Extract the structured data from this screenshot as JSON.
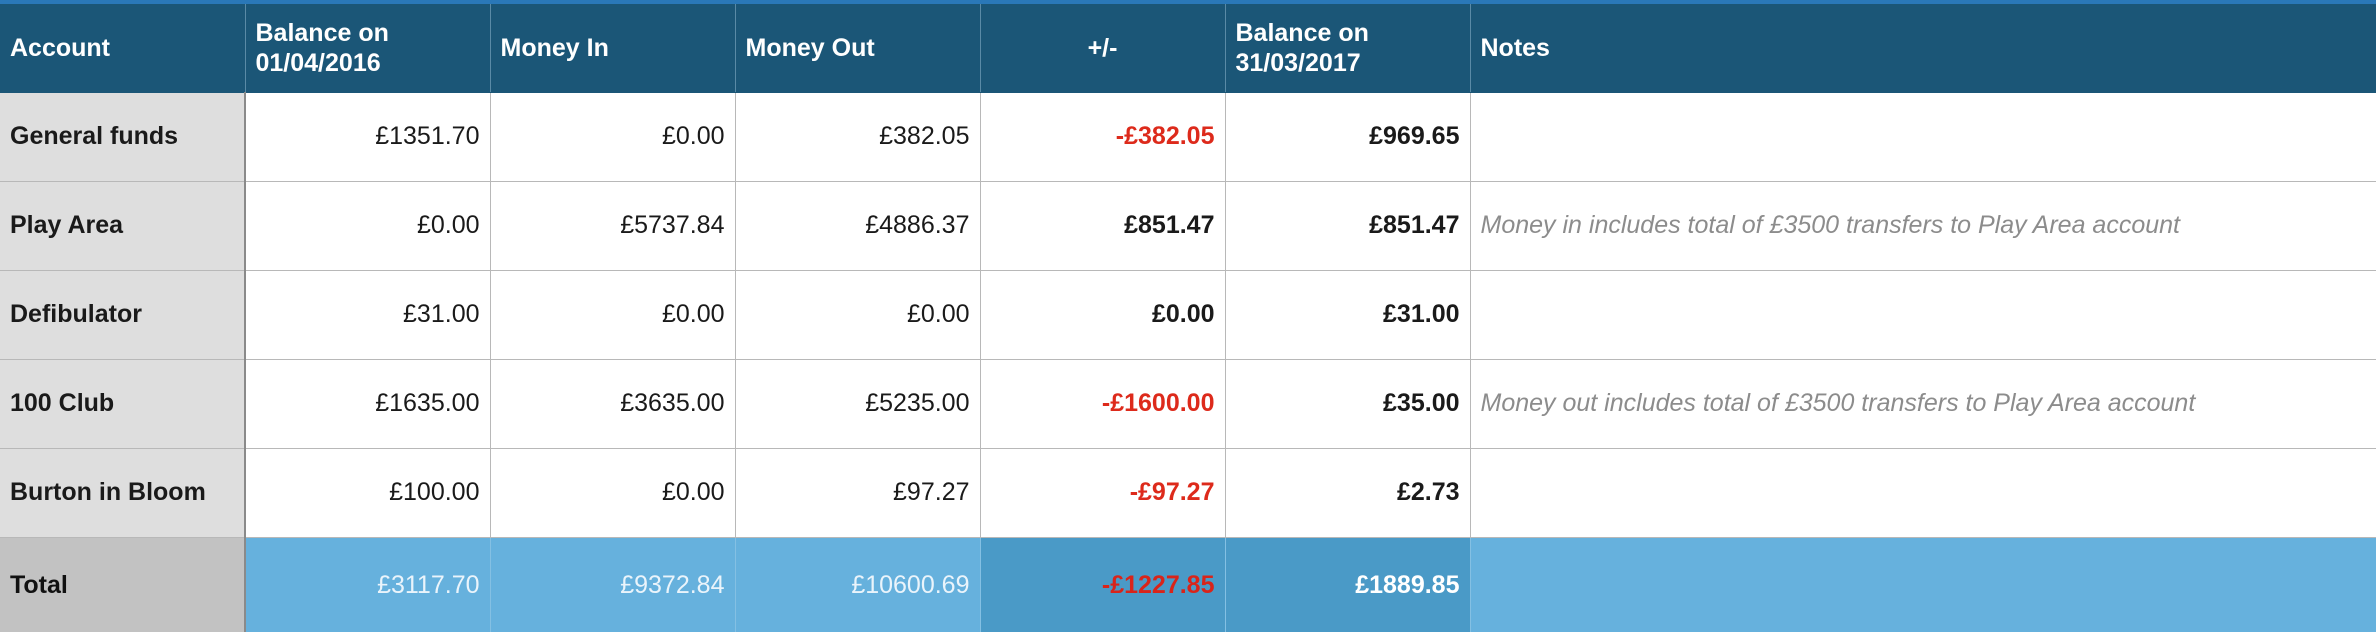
{
  "headers": {
    "account": "Account",
    "balance_start": [
      "Balance on",
      "01/04/2016"
    ],
    "money_in": "Money In",
    "money_out": "Money Out",
    "change": "+/-",
    "balance_end": [
      "Balance on",
      "31/03/2017"
    ],
    "notes": "Notes"
  },
  "rows": [
    {
      "account": "General funds",
      "balance_start": "£1351.70",
      "money_in": "£0.00",
      "money_out": "£382.05",
      "change": "-£382.05",
      "balance_end": "£969.65",
      "notes": ""
    },
    {
      "account": "Play Area",
      "balance_start": "£0.00",
      "money_in": "£5737.84",
      "money_out": "£4886.37",
      "change": "£851.47",
      "balance_end": "£851.47",
      "notes": "Money in includes total of £3500 transfers to Play Area account"
    },
    {
      "account": "Defibulator",
      "balance_start": "£31.00",
      "money_in": "£0.00",
      "money_out": "£0.00",
      "change": "£0.00",
      "balance_end": "£31.00",
      "notes": ""
    },
    {
      "account": "100 Club",
      "balance_start": "£1635.00",
      "money_in": "£3635.00",
      "money_out": "£5235.00",
      "change": "-£1600.00",
      "balance_end": "£35.00",
      "notes": "Money out includes total of £3500 transfers to Play Area account"
    },
    {
      "account": "Burton in Bloom",
      "balance_start": "£100.00",
      "money_in": "£0.00",
      "money_out": "£97.27",
      "change": "-£97.27",
      "balance_end": "£2.73",
      "notes": ""
    }
  ],
  "total": {
    "account": "Total",
    "balance_start": "£3117.70",
    "money_in": "£9372.84",
    "money_out": "£10600.69",
    "change": "-£1227.85",
    "balance_end": "£1889.85",
    "notes": ""
  },
  "colors": {
    "header_bg": "#1b5677",
    "negative": "#dd2a1b",
    "total_bg": "#66b1dd",
    "total_highlight_bg": "#4a9ac7",
    "account_col_bg": "#dedede"
  }
}
